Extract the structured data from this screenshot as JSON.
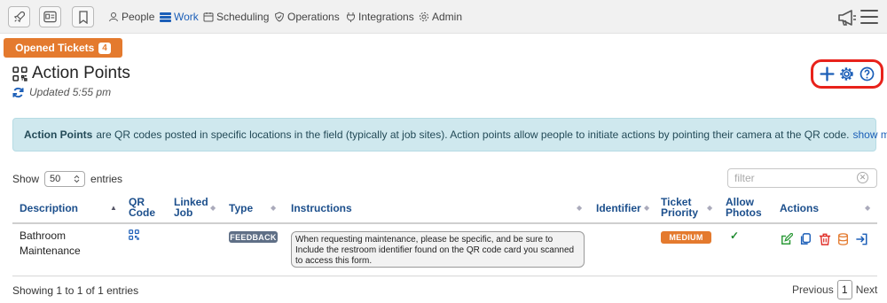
{
  "nav": {
    "people": "People",
    "work": "Work",
    "scheduling": "Scheduling",
    "operations": "Operations",
    "integrations": "Integrations",
    "admin": "Admin"
  },
  "tab": {
    "label": "Opened Tickets",
    "count": "4"
  },
  "page": {
    "title": "Action Points",
    "updated": "Updated 5:55 pm"
  },
  "info": {
    "bold": "Action Points",
    "text": "are QR codes posted in specific locations in the field (typically at job sites). Action points allow people to initiate actions by pointing their camera at the QR code.",
    "more": "show more"
  },
  "length": {
    "show": "Show",
    "value": "50",
    "entries": "entries"
  },
  "filter": {
    "placeholder": "filter"
  },
  "table": {
    "columns": {
      "description": "Description",
      "qr_1": "QR",
      "qr_2": "Code",
      "linked_1": "Linked",
      "linked_2": "Job",
      "type": "Type",
      "instructions": "Instructions",
      "identifier": "Identifier",
      "priority_1": "Ticket",
      "priority_2": "Priority",
      "photos_1": "Allow",
      "photos_2": "Photos",
      "actions": "Actions"
    },
    "rows": [
      {
        "description_1": "Bathroom",
        "description_2": "Maintenance",
        "type": "FEEDBACK",
        "instructions": "When requesting maintenance, please be specific, and be sure to Include the restroom identifier found on the QR code card you scanned to access this form.",
        "identifier": "",
        "priority": "MEDIUM",
        "allow_photos": "✓"
      }
    ]
  },
  "footer": {
    "summary": "Showing 1 to 1 of 1 entries",
    "previous": "Previous",
    "page": "1",
    "next": "Next"
  },
  "colors": {
    "accent": "#e47a2e",
    "link": "#1c5fb8",
    "highlight": "#e8221b",
    "info_bg": "#cfe8ee",
    "feedback": "#5f6f86",
    "medium": "#e47a2e"
  },
  "icons": [
    "rocket-icon",
    "id-card-icon",
    "bookmark-icon",
    "people-icon",
    "work-icon",
    "calendar-icon",
    "shield-icon",
    "plug-icon",
    "gear-icon",
    "megaphone-icon",
    "hamburger-icon",
    "qr-code-icon",
    "refresh-icon",
    "plus-icon",
    "settings-icon",
    "help-icon",
    "edit-icon",
    "copy-icon",
    "trash-icon",
    "database-icon",
    "sign-in-icon"
  ]
}
